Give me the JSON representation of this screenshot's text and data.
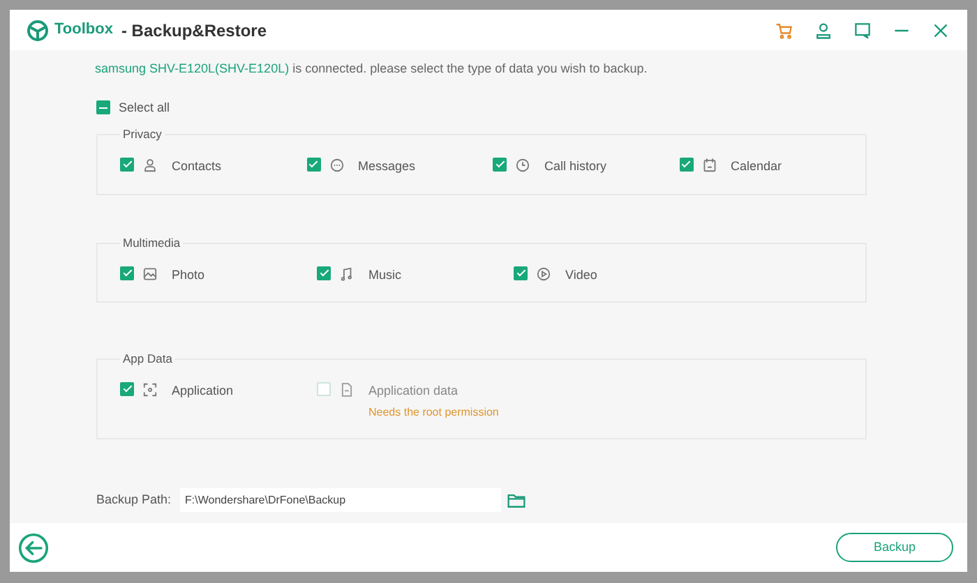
{
  "window": {
    "app": "Toolbox",
    "title": "- Backup&Restore"
  },
  "notice": {
    "device": "samsung SHV-E120L(SHV-E120L)",
    "text": "is connected. please select the type of data you wish to backup."
  },
  "select_all": {
    "label": "Select all",
    "indeterminate": true
  },
  "groups": [
    {
      "title": "Privacy",
      "items": [
        {
          "label": "Contacts",
          "checked": true,
          "disabled": false
        },
        {
          "label": "Messages",
          "checked": true,
          "disabled": false
        },
        {
          "label": "Call history",
          "checked": true,
          "disabled": false
        },
        {
          "label": "Calendar",
          "checked": true,
          "disabled": false
        }
      ]
    },
    {
      "title": "Multimedia",
      "items": [
        {
          "label": "Photo",
          "checked": true,
          "disabled": false
        },
        {
          "label": "Music",
          "checked": true,
          "disabled": false
        },
        {
          "label": "Video",
          "checked": true,
          "disabled": false
        }
      ]
    },
    {
      "title": "App Data",
      "items": [
        {
          "label": "Application",
          "checked": true,
          "disabled": false
        },
        {
          "label": "Application data",
          "checked": false,
          "disabled": true,
          "note": "Needs the root permission"
        }
      ]
    }
  ],
  "backup_path": {
    "label": "Backup Path:",
    "value": "F:\\Wondershare\\DrFone\\Backup"
  },
  "buttons": [
    "Backup"
  ]
}
